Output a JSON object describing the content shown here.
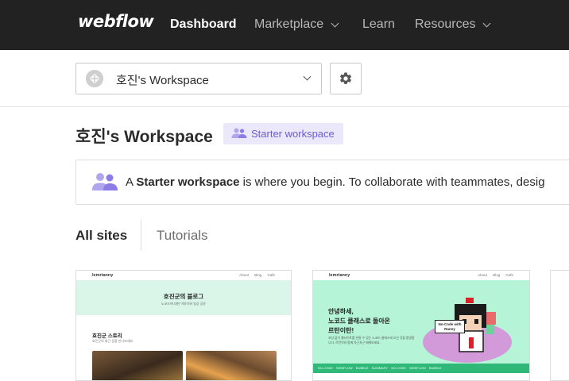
{
  "nav": {
    "logo": "webflow",
    "items": [
      {
        "label": "Dashboard",
        "active": true,
        "dropdown": false
      },
      {
        "label": "Marketplace",
        "active": false,
        "dropdown": true
      },
      {
        "label": "Learn",
        "active": false,
        "dropdown": false
      },
      {
        "label": "Resources",
        "active": false,
        "dropdown": true
      }
    ]
  },
  "workspace_selector": {
    "selected": "호진's Workspace",
    "icon": "workspace-avatar-icon",
    "settings_icon": "gear-icon"
  },
  "page": {
    "title": "호진's Workspace",
    "badge": {
      "label": "Starter workspace",
      "icon": "users-icon",
      "color": "#6a5bd6",
      "background": "#ece8fb"
    }
  },
  "info_banner": {
    "prefix": "A ",
    "emphasis": "Starter workspace",
    "suffix": " is where you begin. To collaborate with teammates, desig"
  },
  "tabs": [
    {
      "label": "All sites",
      "active": true
    },
    {
      "label": "Tutorials",
      "active": false
    }
  ],
  "sites": [
    {
      "logo": "lemrtanny",
      "nav_links": "About Blog Cafe",
      "hero_title": "호진군의 블로그",
      "hero_subtitle": "노코드에 대한 이야기와 일상 공유",
      "section_title": "호진군 스토리",
      "section_subtitle": "호진군의 최근 글을 만나보세요"
    },
    {
      "logo": "lemrtanny",
      "nav_links": "About Blog Cafe",
      "hero_lines": [
        "안녕하세,",
        "노코드 클래스로 돌아온",
        "르탄이탄!"
      ],
      "body": "코딩 없이 웹사이트를 만들 수 있는 노코드 클래스에 오신 것을 환영합니다. 르탄이와 함께 차근차근 배워보세요.",
      "tag": "No-Code with Ranny",
      "strip": "NO-CODE WEBFLOW BUBBLE SUMMARY NO-CODE WEBFLOW BUBBLE"
    }
  ],
  "colors": {
    "nav_bg": "#222222",
    "accent": "#6a5bd6",
    "card1_hero": "#d9f6e8",
    "card2_hero": "#b5f4d7"
  }
}
